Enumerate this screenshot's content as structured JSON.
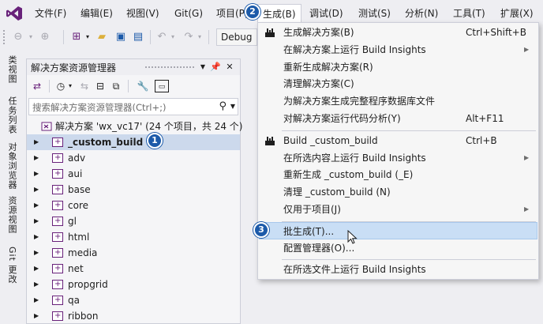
{
  "menubar": {
    "items": [
      {
        "label": "文件(F)"
      },
      {
        "label": "编辑(E)"
      },
      {
        "label": "视图(V)"
      },
      {
        "label": "Git(G)"
      },
      {
        "label": "项目(P)"
      },
      {
        "label": "生成(B)"
      },
      {
        "label": "调试(D)"
      },
      {
        "label": "测试(S)"
      },
      {
        "label": "分析(N)"
      },
      {
        "label": "工具(T)"
      },
      {
        "label": "扩展(X)"
      }
    ]
  },
  "toolbar": {
    "config": "Debug"
  },
  "side_tabs": [
    "类视图",
    "任务列表",
    "对象浏览器",
    "资源视图",
    "Git 更改"
  ],
  "solution_explorer": {
    "title": "解决方案资源管理器",
    "search_placeholder": "搜索解决方案资源管理器(Ctrl+;)",
    "solution": "解决方案 'wx_vc17' (24 个项目，共 24 个)",
    "projects": [
      "_custom_build",
      "adv",
      "aui",
      "base",
      "core",
      "gl",
      "html",
      "media",
      "net",
      "propgrid",
      "qa",
      "ribbon"
    ]
  },
  "build_menu": {
    "items": [
      {
        "label": "生成解决方案(B)",
        "shortcut": "Ctrl+Shift+B"
      },
      {
        "label": "在解决方案上运行 Build Insights",
        "shortcut": ""
      },
      {
        "label": "重新生成解决方案(R)",
        "shortcut": ""
      },
      {
        "label": "清理解决方案(C)",
        "shortcut": ""
      },
      {
        "label": "为解决方案生成完整程序数据库文件",
        "shortcut": ""
      },
      {
        "label": "对解决方案运行代码分析(Y)",
        "shortcut": "Alt+F11"
      },
      {
        "label": "Build _custom_build",
        "shortcut": "Ctrl+B"
      },
      {
        "label": "在所选内容上运行 Build Insights",
        "shortcut": ""
      },
      {
        "label": "重新生成 _custom_build (_E)",
        "shortcut": ""
      },
      {
        "label": "清理 _custom_build (N)",
        "shortcut": ""
      },
      {
        "label": "仅用于项目(J)",
        "shortcut": ""
      },
      {
        "label": "批生成(T)...",
        "shortcut": ""
      },
      {
        "label": "配置管理器(O)...",
        "shortcut": ""
      },
      {
        "label": "在所选文件上运行 Build Insights",
        "shortcut": ""
      }
    ]
  },
  "callouts": [
    "1",
    "2",
    "3"
  ],
  "colors": {
    "accent": "#1c5aa9",
    "highlight": "#c9def5",
    "selection": "#ccd9ec",
    "vs_purple": "#68217a"
  }
}
